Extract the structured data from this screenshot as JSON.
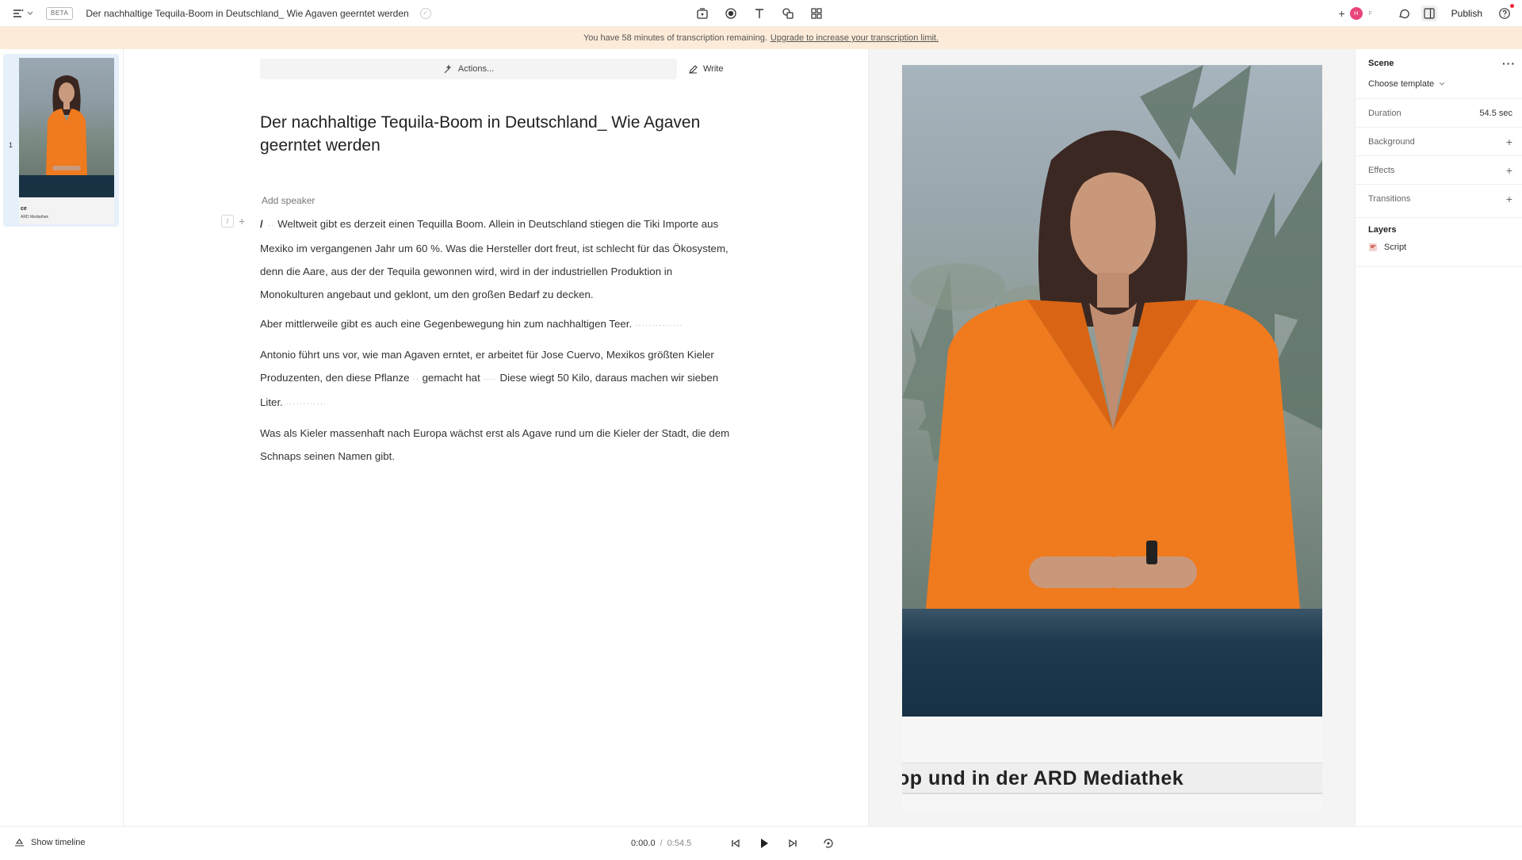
{
  "topbar": {
    "beta_label": "BETA",
    "doc_title": "Der nachhaltige Tequila-Boom in Deutschland_ Wie Agaven geerntet werden",
    "avatar_initial": "H",
    "avatar_second": "F",
    "publish_label": "Publish"
  },
  "banner": {
    "text": "You have 58 minutes of transcription remaining.",
    "link": "Upgrade to increase your transcription limit."
  },
  "scenes": {
    "items": [
      {
        "number": "1",
        "thumb_caption": "ARD Mediathek"
      }
    ]
  },
  "editor": {
    "actions_label": "Actions...",
    "write_label": "Write",
    "title": "Der nachhaltige Tequila-Boom in Deutschland_ Wie Agaven geerntet werden",
    "add_speaker": "Add speaker",
    "slash": "/",
    "paragraphs": [
      "Weltweit gibt es derzeit einen Tequilla Boom. Allein in Deutschland stiegen die Tiki Importe aus Mexiko im vergangenen Jahr um 60   %. Was die Hersteller dort freut, ist schlecht für das Ökosystem, denn die Aare, aus der der Tequila gewonnen wird, wird in der industriellen Produktion in Monokulturen angebaut und geklont, um den großen Bedarf zu decken.",
      "Aber mittlerweile gibt es auch eine Gegenbewegung hin zum nachhaltigen Teer.",
      "Antonio führt uns vor, wie man Agaven erntet, er arbeitet für Jose Cuervo, Mexikos größten Kieler Produzenten, den diese Pflanze",
      "Was als Kieler massenhaft nach Europa wächst erst als Agave rund um die Kieler der Stadt, die dem Schnaps seinen Namen gibt."
    ],
    "para3_mid": "gemacht hat",
    "para3_end": "Diese wiegt 50 Kilo, daraus machen wir sieben Liter."
  },
  "preview": {
    "ticker": "op und in der ARD Mediathek"
  },
  "props": {
    "scene_label": "Scene",
    "template_label": "Choose template",
    "duration_label": "Duration",
    "duration_value": "54.5 sec",
    "background_label": "Background",
    "effects_label": "Effects",
    "transitions_label": "Transitions",
    "layers_label": "Layers",
    "layer_item": "Script"
  },
  "bottombar": {
    "show_timeline": "Show timeline",
    "current_time": "0:00.0",
    "separator": "/",
    "total_time": "0:54.5"
  },
  "colors": {
    "banner_bg": "#fcebd9",
    "scene_selected": "#e6f0fb",
    "jacket_orange": "#f07a1e",
    "avatar_pink": "#e8457a"
  }
}
